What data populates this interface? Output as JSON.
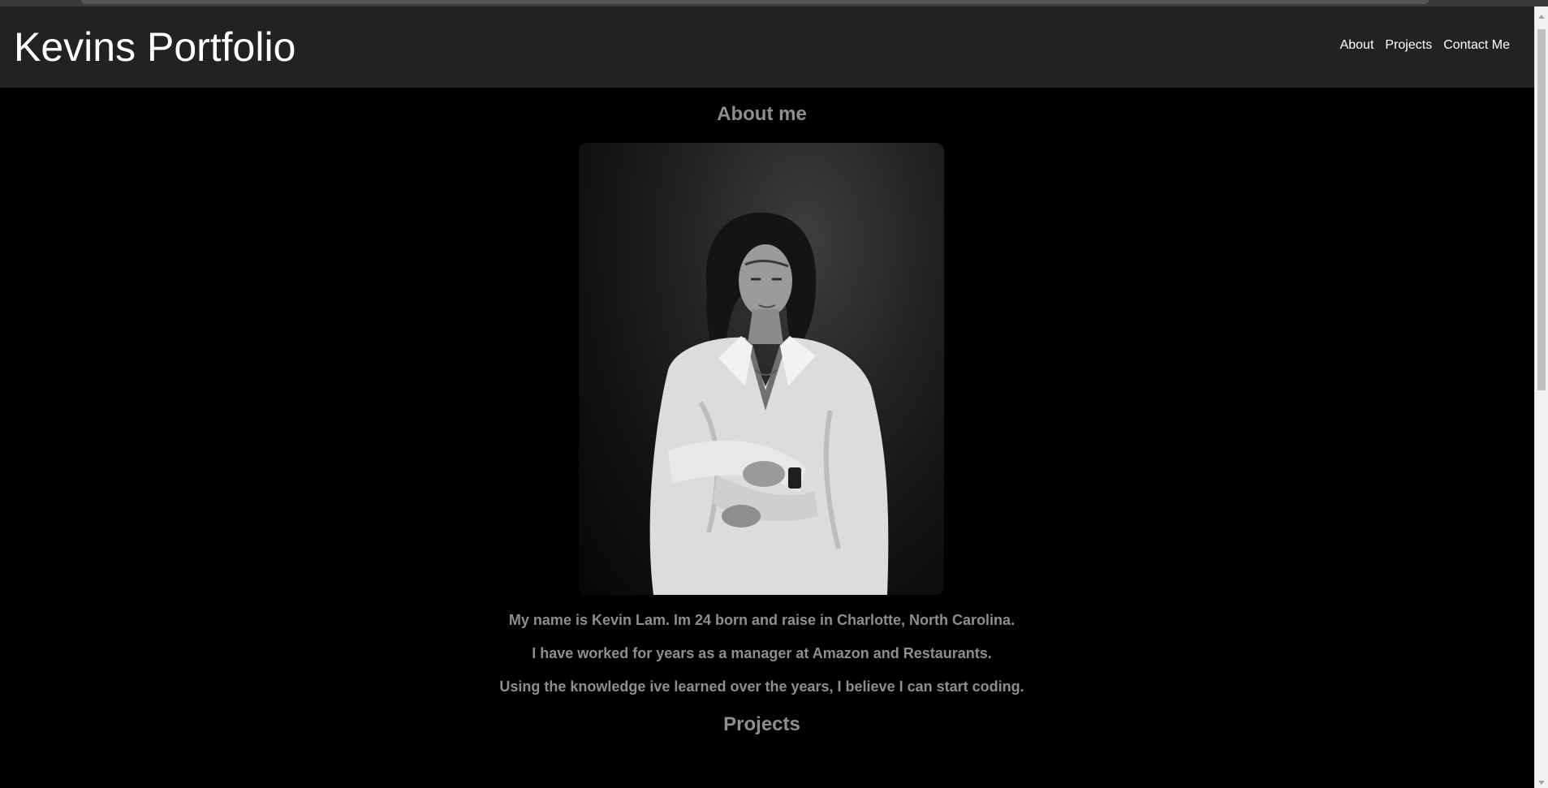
{
  "header": {
    "title": "Kevins Portfolio",
    "nav": [
      {
        "label": "About"
      },
      {
        "label": "Projects"
      },
      {
        "label": "Contact Me"
      }
    ]
  },
  "about": {
    "heading": "About me",
    "bio": [
      "My name is Kevin Lam. Im 24 born and raise in Charlotte, North Carolina.",
      "I have worked for years as a manager at Amazon and Restaurants.",
      "Using the knowledge ive learned over the years, I believe I can start coding."
    ]
  },
  "projects": {
    "heading": "Projects"
  },
  "colors": {
    "header_bg": "#222222",
    "page_bg": "#000000",
    "heading_text": "#8e8e8e",
    "nav_text": "#ffffff"
  }
}
